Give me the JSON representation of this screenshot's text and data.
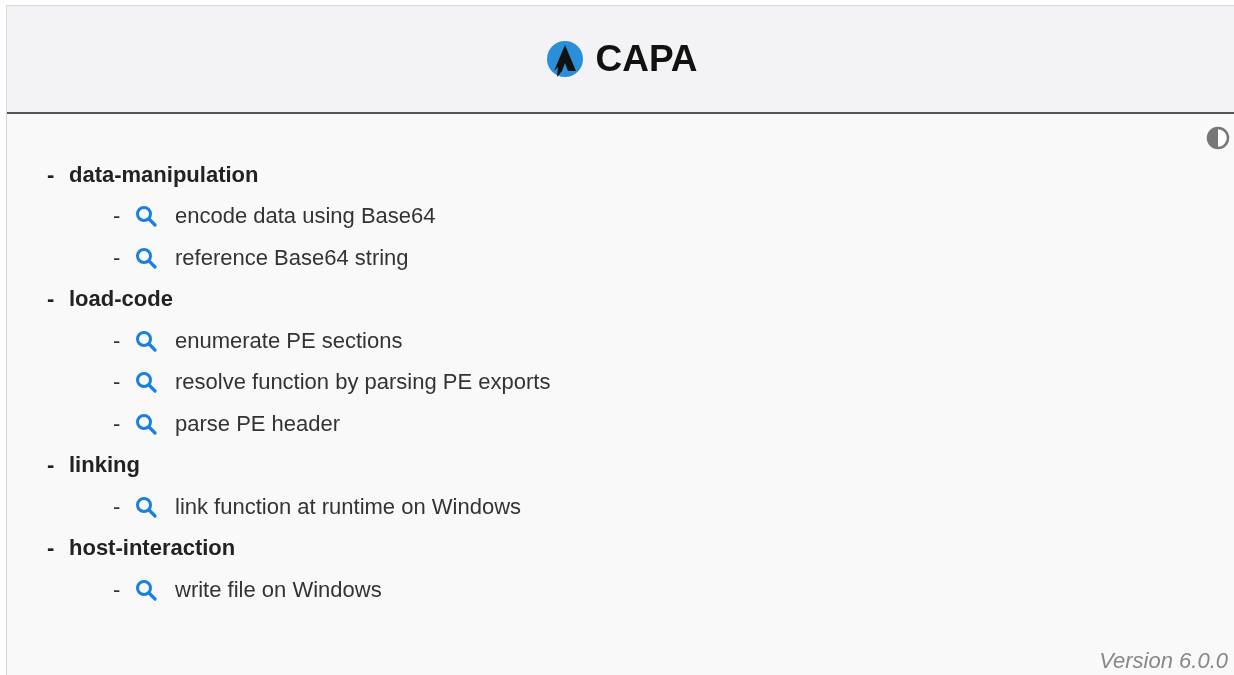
{
  "header": {
    "logo_text": "CAPA"
  },
  "tree": [
    {
      "label": "-",
      "name": "data-manipulation",
      "children": [
        {
          "label": "-",
          "name": "encode data using Base64"
        },
        {
          "label": "-",
          "name": "reference Base64 string"
        }
      ]
    },
    {
      "label": "-",
      "name": "load-code",
      "children": [
        {
          "label": "-",
          "name": "enumerate PE sections"
        },
        {
          "label": "-",
          "name": "resolve function by parsing PE exports"
        },
        {
          "label": "-",
          "name": "parse PE header"
        }
      ]
    },
    {
      "label": "-",
      "name": "linking",
      "children": [
        {
          "label": "-",
          "name": "link function at runtime on Windows"
        }
      ]
    },
    {
      "label": "-",
      "name": "host-interaction",
      "children": [
        {
          "label": "-",
          "name": "write file on Windows"
        }
      ]
    }
  ],
  "footer": {
    "version": "Version 6.0.0"
  }
}
